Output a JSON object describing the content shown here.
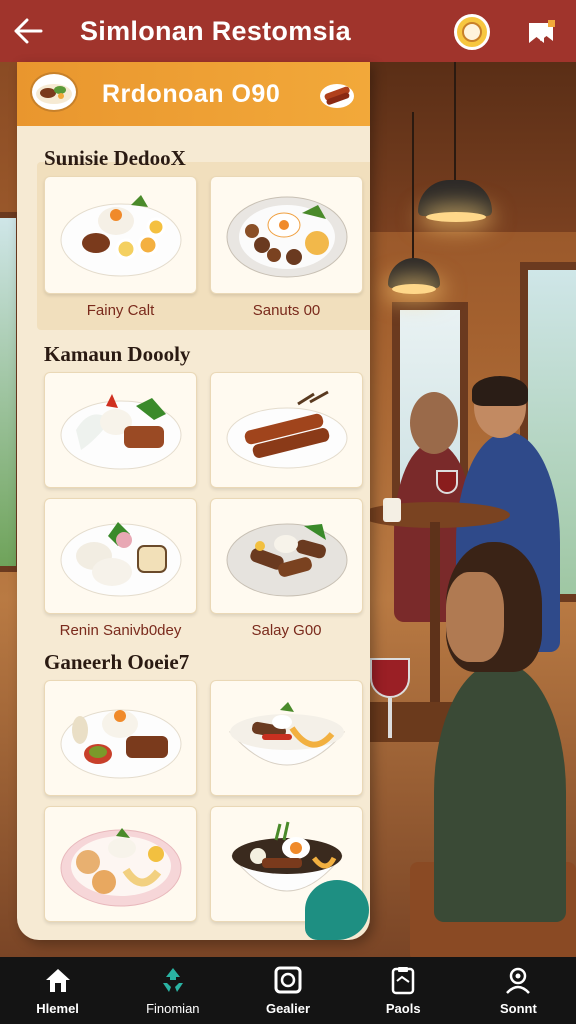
{
  "header": {
    "title": "Simlonan Restomsia",
    "back_icon": "arrow-left-icon",
    "avatar_icon": "face-avatar-icon",
    "bookmark_icon": "bookmark-icon"
  },
  "panel": {
    "banner_title": "Rrdonoan O90",
    "sections": [
      {
        "title": "Sunisie DedooX",
        "dishes": [
          {
            "label": "Fainy Calt"
          },
          {
            "label": "Sanuts 00"
          }
        ]
      },
      {
        "title": "Kamaun Doooly",
        "dishes": [
          {
            "label": ""
          },
          {
            "label": ""
          },
          {
            "label": "Renin Sanivb0dey"
          },
          {
            "label": "Salay G00"
          }
        ]
      },
      {
        "title": "Ganeerh Ooeie7",
        "dishes": [
          {
            "label": ""
          },
          {
            "label": ""
          },
          {
            "label": ""
          },
          {
            "label": ""
          }
        ]
      }
    ]
  },
  "bottom_nav": {
    "items": [
      {
        "label": "Hlemel",
        "icon": "home-icon"
      },
      {
        "label": "Finomian",
        "icon": "recycle-icon",
        "active": true
      },
      {
        "label": "Gealier",
        "icon": "frame-icon"
      },
      {
        "label": "Paols",
        "icon": "clipboard-icon"
      },
      {
        "label": "Sonnt",
        "icon": "user-gear-icon"
      }
    ]
  },
  "colors": {
    "header": "#a0342c",
    "banner": "#f2a93a",
    "panel": "#f6ead3",
    "nav": "#141414",
    "accent": "#1e8f82"
  }
}
